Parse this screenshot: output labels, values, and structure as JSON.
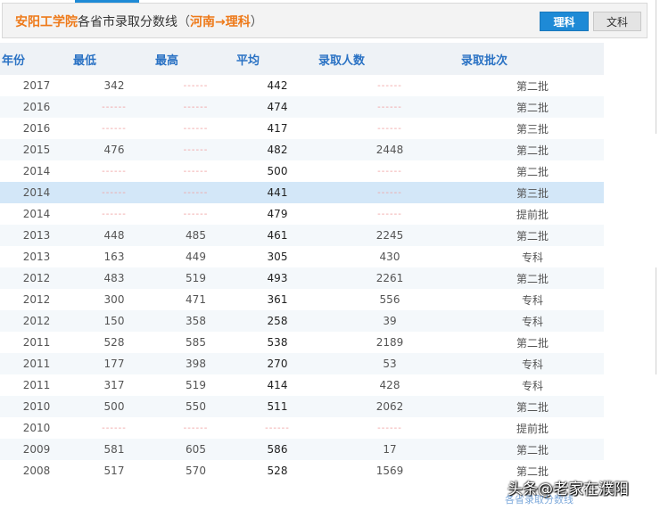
{
  "header": {
    "school": "安阳工学院",
    "title_main": "各省市录取分数线",
    "paren_open": "（",
    "region": "河南→理科",
    "paren_close": "）",
    "tab_science": "理科",
    "tab_arts": "文科"
  },
  "table": {
    "columns": [
      "年份",
      "最低",
      "最高",
      "平均",
      "录取人数",
      "录取批次"
    ],
    "rows": [
      [
        "2017",
        "342",
        "------",
        "442",
        "------",
        "第二批"
      ],
      [
        "2016",
        "------",
        "------",
        "474",
        "------",
        "第二批"
      ],
      [
        "2016",
        "------",
        "------",
        "417",
        "------",
        "第三批"
      ],
      [
        "2015",
        "476",
        "------",
        "482",
        "2448",
        "第二批"
      ],
      [
        "2014",
        "------",
        "------",
        "500",
        "------",
        "第二批"
      ],
      [
        "2014",
        "------",
        "------",
        "441",
        "------",
        "第三批"
      ],
      [
        "2014",
        "------",
        "------",
        "479",
        "------",
        "提前批"
      ],
      [
        "2013",
        "448",
        "485",
        "461",
        "2245",
        "第二批"
      ],
      [
        "2013",
        "163",
        "449",
        "305",
        "430",
        "专科"
      ],
      [
        "2012",
        "483",
        "519",
        "493",
        "2261",
        "第二批"
      ],
      [
        "2012",
        "300",
        "471",
        "361",
        "556",
        "专科"
      ],
      [
        "2012",
        "150",
        "358",
        "258",
        "39",
        "专科"
      ],
      [
        "2011",
        "528",
        "585",
        "538",
        "2189",
        "第二批"
      ],
      [
        "2011",
        "177",
        "398",
        "270",
        "53",
        "专科"
      ],
      [
        "2011",
        "317",
        "519",
        "414",
        "428",
        "专科"
      ],
      [
        "2010",
        "500",
        "550",
        "511",
        "2062",
        "第二批"
      ],
      [
        "2010",
        "------",
        "------",
        "------",
        "------",
        "提前批"
      ],
      [
        "2009",
        "581",
        "605",
        "586",
        "17",
        "第二批"
      ],
      [
        "2008",
        "517",
        "570",
        "528",
        "1569",
        "第二批"
      ]
    ]
  },
  "highlight_row": 5,
  "watermark": "头条@老家在濮阳",
  "bottom_link": "各省录取分数线",
  "colors": {
    "accent": "#1e8ad6",
    "school_orange": "#ee7a1a",
    "header_text": "#2a72c4",
    "dash": "#f0a0a0",
    "highlight": "#d3e7f8"
  }
}
